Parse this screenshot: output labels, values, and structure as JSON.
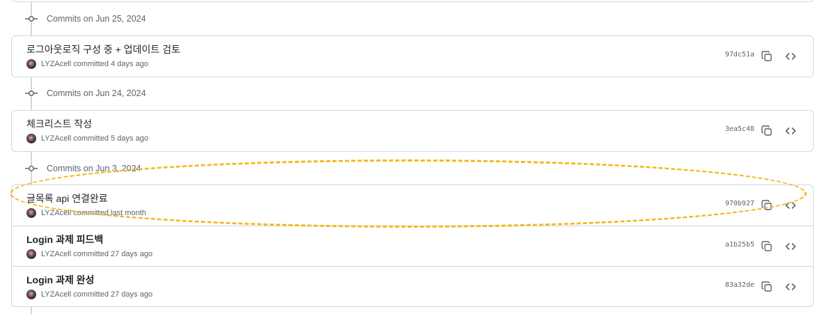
{
  "groups": [
    {
      "label": "Commits on Jun 25, 2024",
      "commits": [
        {
          "message": "로그아웃로직 구성 중 + 업데이트 검토",
          "author": "LYZAcell",
          "time": "committed 4 days ago",
          "sha": "97dc51a"
        }
      ]
    },
    {
      "label": "Commits on Jun 24, 2024",
      "commits": [
        {
          "message": "체크리스트 작성",
          "author": "LYZAcell",
          "time": "committed 5 days ago",
          "sha": "3ea5c48"
        }
      ]
    },
    {
      "label": "Commits on Jun 3, 2024",
      "commits": [
        {
          "message": "글목록 api 연결완료",
          "author": "LYZAcell",
          "time": "committed last month",
          "sha": "970b927"
        },
        {
          "message": "Login 과제 피드백",
          "author": "LYZAcell",
          "time": "committed 27 days ago",
          "sha": "a1b25b5"
        },
        {
          "message": "Login 과제 완성",
          "author": "LYZAcell",
          "time": "committed 27 days ago",
          "sha": "83a32de"
        }
      ]
    }
  ],
  "icons": {
    "commit_node": "git-commit-icon",
    "copy": "copy-icon",
    "browse": "code-icon"
  },
  "colors": {
    "highlight": "#f2b81a",
    "border": "#d0d7de",
    "muted_text": "#59636e"
  }
}
